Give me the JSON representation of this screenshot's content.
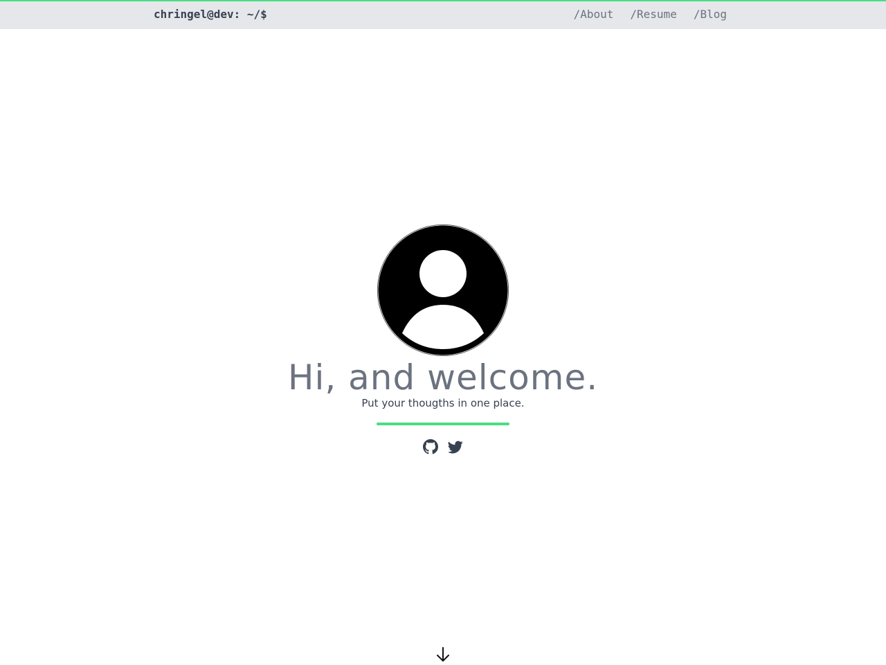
{
  "header": {
    "brand": "chringel@dev: ~/$",
    "nav": [
      {
        "label": "/About"
      },
      {
        "label": "/Resume"
      },
      {
        "label": "/Blog"
      }
    ]
  },
  "hero": {
    "avatar_icon": "user-avatar-icon",
    "headline": "Hi, and welcome.",
    "tagline": "Put your thougths in one place."
  },
  "socials": [
    {
      "icon": "github-icon"
    },
    {
      "icon": "twitter-icon"
    }
  ],
  "scroll": {
    "icon": "arrow-down-icon"
  },
  "colors": {
    "accent": "#4ade80",
    "header_bg": "#e5e7eb",
    "text_dark": "#374151",
    "text_muted": "#6b7280"
  }
}
